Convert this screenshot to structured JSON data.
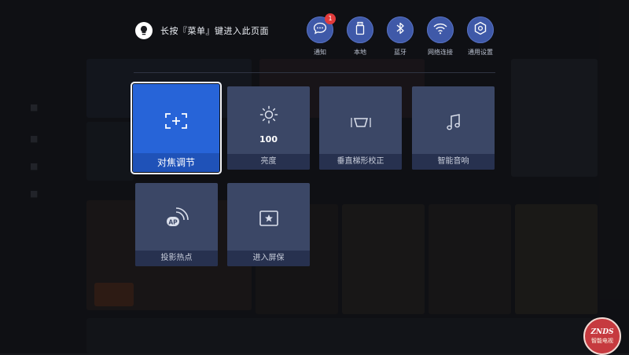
{
  "hint": {
    "text": "长按『菜单』键进入此页面"
  },
  "quick_actions": [
    {
      "id": "notify",
      "label": "通知",
      "icon": "message-icon",
      "badge": "1"
    },
    {
      "id": "local",
      "label": "本地",
      "icon": "usb-drive-icon"
    },
    {
      "id": "bluetooth",
      "label": "蓝牙",
      "icon": "bluetooth-icon"
    },
    {
      "id": "network",
      "label": "网络连接",
      "icon": "wifi-icon"
    },
    {
      "id": "settings",
      "label": "通用设置",
      "icon": "hexagon-settings-icon"
    }
  ],
  "tiles": [
    {
      "label": "对焦调节",
      "icon": "focus-adjust-icon",
      "selected": true
    },
    {
      "label": "亮度",
      "icon": "brightness-icon",
      "value": "100"
    },
    {
      "label": "垂直梯形校正",
      "icon": "keystone-icon"
    },
    {
      "label": "智能音响",
      "icon": "music-note-icon"
    },
    {
      "label": "投影热点",
      "icon": "ap-hotspot-icon"
    },
    {
      "label": "进入屏保",
      "icon": "screensaver-icon"
    }
  ],
  "watermark": {
    "line1": "ZNDS",
    "line2": "智能电视"
  },
  "colors": {
    "accent": "#2764d8",
    "tile": "#3b4766",
    "badge": "#e23b3b"
  }
}
